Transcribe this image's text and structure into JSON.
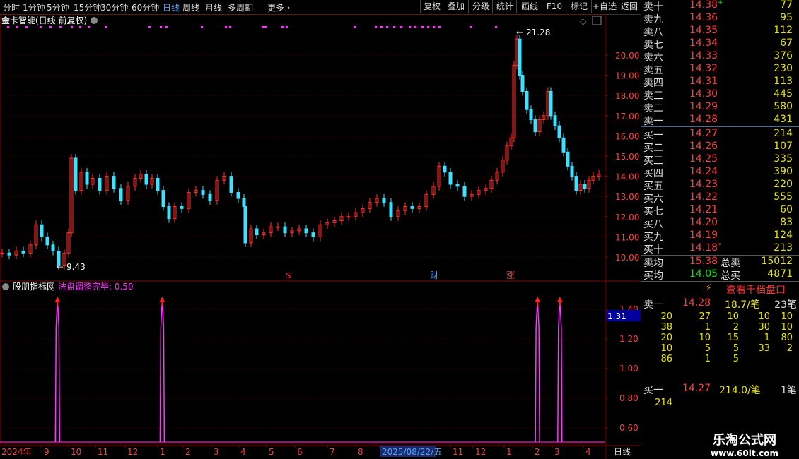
{
  "toolbar": {
    "periods": [
      "分时",
      "1分钟",
      "5分钟",
      "15分钟",
      "30分钟",
      "60分钟",
      "日线",
      "周线",
      "月线",
      "多周期",
      "更多"
    ],
    "active_period": "日线",
    "buttons": [
      "复权",
      "叠加",
      "分级",
      "统计",
      "画线",
      "F10",
      "标记",
      "+自选",
      "返回"
    ]
  },
  "chart": {
    "stock_title": "金卡智能(日线 前复权)",
    "price_axis": [
      "20.00",
      "19.00",
      "18.00",
      "17.00",
      "16.00",
      "15.00",
      "14.00",
      "13.00",
      "12.00",
      "11.00",
      "10.00"
    ],
    "high_label": "21.28",
    "low_label": "9.43",
    "event_markers": [
      "$",
      "财",
      "涨"
    ],
    "indicator_title": "股朋指标网",
    "indicator_name": "洗盘调整完毕",
    "indicator_value": "0.50",
    "indicator_axis": [
      "1.40",
      "1.20",
      "1.00",
      "0.80",
      "0.60"
    ],
    "indicator_current": "1.31",
    "date_axis": [
      "2024年",
      "9",
      "10",
      "11",
      "12",
      "1",
      "2",
      "3",
      "4",
      "5",
      "6",
      "7",
      "8",
      "2025/08/22/五",
      "11",
      "12",
      "1",
      "2",
      "3",
      "4"
    ],
    "period_label": "日线"
  },
  "chart_data": {
    "type": "line",
    "title": "洗盘调整完毕",
    "ylim": [
      0.5,
      1.5
    ],
    "signals_x_fraction": [
      0.095,
      0.268,
      0.888,
      0.925
    ],
    "signal_value": 1.0,
    "baseline": 0.5
  },
  "orderbook": {
    "sells": [
      {
        "label": "卖十",
        "price": "14.38",
        "vol": "77",
        "mark": "+"
      },
      {
        "label": "卖九",
        "price": "14.36",
        "vol": "95"
      },
      {
        "label": "卖八",
        "price": "14.35",
        "vol": "112"
      },
      {
        "label": "卖七",
        "price": "14.34",
        "vol": "67"
      },
      {
        "label": "卖六",
        "price": "14.33",
        "vol": "376"
      },
      {
        "label": "卖五",
        "price": "14.32",
        "vol": "230"
      },
      {
        "label": "卖四",
        "price": "14.31",
        "vol": "113"
      },
      {
        "label": "卖三",
        "price": "14.30",
        "vol": "445"
      },
      {
        "label": "卖二",
        "price": "14.29",
        "vol": "580"
      },
      {
        "label": "卖一",
        "price": "14.28",
        "vol": "431"
      }
    ],
    "buys": [
      {
        "label": "买一",
        "price": "14.27",
        "vol": "214"
      },
      {
        "label": "买二",
        "price": "14.26",
        "vol": "107"
      },
      {
        "label": "买三",
        "price": "14.25",
        "vol": "335"
      },
      {
        "label": "买四",
        "price": "14.24",
        "vol": "390"
      },
      {
        "label": "买五",
        "price": "14.23",
        "vol": "220"
      },
      {
        "label": "买六",
        "price": "14.22",
        "vol": "555"
      },
      {
        "label": "买七",
        "price": "14.21",
        "vol": "60"
      },
      {
        "label": "买八",
        "price": "14.20",
        "vol": "83"
      },
      {
        "label": "买九",
        "price": "14.19",
        "vol": "124"
      },
      {
        "label": "买十",
        "price": "14.18",
        "vol": "213",
        "mark": "*"
      }
    ],
    "avg_sell_label": "卖均",
    "avg_sell": "15.38",
    "total_sell_label": "总卖",
    "total_sell": "15012",
    "avg_buy_label": "买均",
    "avg_buy": "14.05",
    "total_buy_label": "总买",
    "total_buy": "4871",
    "thousand_btn": "查看千档盘口",
    "queue_sell": {
      "label": "卖一",
      "price": "14.28",
      "per": "18.7/笔",
      "count": "23笔",
      "rows": [
        [
          "20",
          "27",
          "10",
          "10",
          "10"
        ],
        [
          "38",
          "1",
          "2",
          "30",
          "10"
        ],
        [
          "20",
          "10",
          "15",
          "1",
          "80"
        ],
        [
          "10",
          "5",
          "5",
          "33",
          "2"
        ],
        [
          "86",
          "1",
          "5",
          "",
          ""
        ]
      ]
    },
    "queue_buy": {
      "label": "买一",
      "price": "14.27",
      "per": "214.0/笔",
      "count": "1笔",
      "rows": [
        [
          "214"
        ]
      ]
    }
  },
  "watermark": {
    "line1": "乐淘公式网",
    "line2": "www.60lt.com"
  }
}
